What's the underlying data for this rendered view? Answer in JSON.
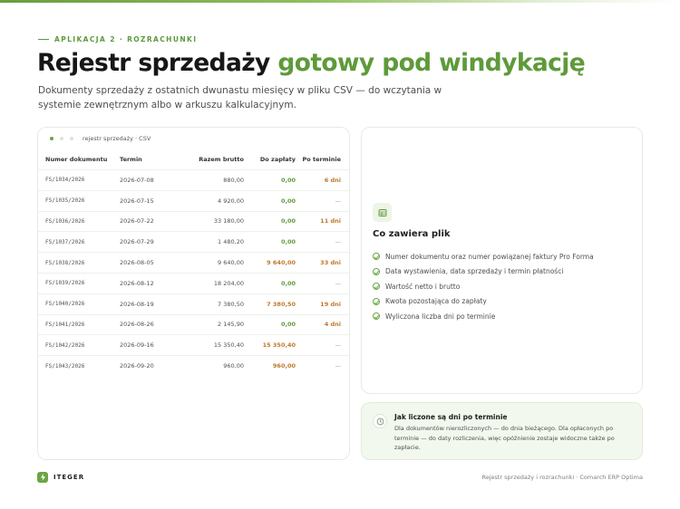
{
  "eyebrow": "APLIKACJA 2 · ROZRACHUNKI",
  "title": {
    "main": "Rejestr sprzedaży",
    "accent": "gotowy pod windykację"
  },
  "lead": "Dokumenty sprzedaży z ostatnich dwunastu miesięcy w pliku CSV — do wczytania w systemie zewnętrznym albo w arkuszu kalkulacyjnym.",
  "table": {
    "window_title": "rejestr sprzedaży · CSV",
    "headers": [
      "Numer dokumentu",
      "Termin",
      "Razem brutto",
      "Do zapłaty",
      "Po terminie"
    ],
    "rows": [
      {
        "doc": "FS/1034/2026",
        "due": "2026-07-08",
        "gross": "880,00",
        "topay": "0,00",
        "late": "6 dni"
      },
      {
        "doc": "FS/1035/2026",
        "due": "2026-07-15",
        "gross": "4 920,00",
        "topay": "0,00",
        "late": "—"
      },
      {
        "doc": "FS/1036/2026",
        "due": "2026-07-22",
        "gross": "33 180,00",
        "topay": "0,00",
        "late": "11 dni"
      },
      {
        "doc": "FS/1037/2026",
        "due": "2026-07-29",
        "gross": "1 480,20",
        "topay": "0,00",
        "late": "—"
      },
      {
        "doc": "FS/1038/2026",
        "due": "2026-08-05",
        "gross": "9 640,00",
        "topay": "9 640,00",
        "late": "33 dni"
      },
      {
        "doc": "FS/1039/2026",
        "due": "2026-08-12",
        "gross": "18 204,00",
        "topay": "0,00",
        "late": "—"
      },
      {
        "doc": "FS/1040/2026",
        "due": "2026-08-19",
        "gross": "7 380,50",
        "topay": "7 380,50",
        "late": "19 dni"
      },
      {
        "doc": "FS/1041/2026",
        "due": "2026-08-26",
        "gross": "2 145,90",
        "topay": "0,00",
        "late": "4 dni"
      },
      {
        "doc": "FS/1042/2026",
        "due": "2026-09-16",
        "gross": "15 350,40",
        "topay": "15 350,40",
        "late": "—"
      },
      {
        "doc": "FS/1043/2026",
        "due": "2026-09-20",
        "gross": "960,00",
        "topay": "960,00",
        "late": "—"
      }
    ]
  },
  "info": {
    "icon": "table-icon",
    "title": "Co zawiera plik",
    "items": [
      "Numer dokumentu oraz numer powiązanej faktury Pro Forma",
      "Data wystawienia, data sprzedaży i termin płatności",
      "Wartość netto i brutto",
      "Kwota pozostająca do zapłaty",
      "Wyliczona liczba dni po terminie"
    ]
  },
  "note": {
    "icon": "clock-icon",
    "title": "Jak liczone są dni po terminie",
    "body": "Dla dokumentów nierozliczonych — do dnia bieżącego. Dla opłaconych po terminie — do daty rozliczenia, więc opóźnienie zostaje widoczne także po zapłacie."
  },
  "footer": {
    "logo_text": "ITEGER",
    "right": "Rejestr sprzedaży i rozrachunki · Comarch ERP Optima"
  },
  "colors": {
    "accent": "#5e9a3a",
    "overdue": "#c0782a"
  }
}
